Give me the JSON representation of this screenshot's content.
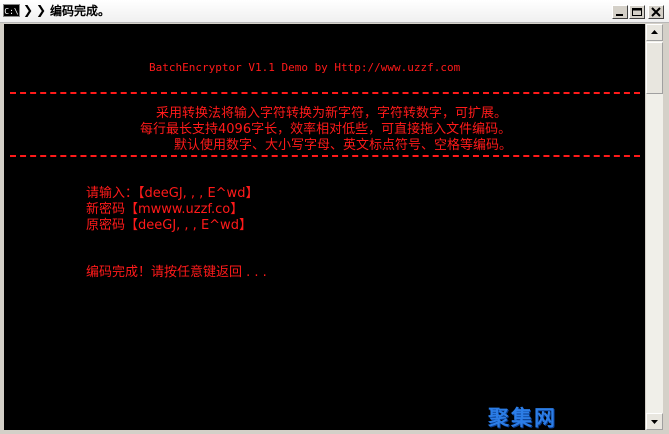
{
  "window": {
    "icon_label": "C:\\",
    "breadcrumb_1": "❯",
    "breadcrumb_2": "❯",
    "title": "编码完成。"
  },
  "console": {
    "banner": "BatchEncryptor V1.1 Demo by Http://www.uzzf.com",
    "desc_1": "采用转换法将输入字符转换为新字符，字符转数字，可扩展。",
    "desc_2": "每行最长支持4096字长，效率相对低些，可直接拖入文件编码。",
    "desc_3": "默认使用数字、大小写字母、英文标点符号、空格等编码。",
    "input_line": "请输入：【deeGJ, , , E^wd】",
    "new_pwd_line": "新密码【mwww.uzzf.co】",
    "orig_pwd_line": "原密码【deeGJ, , , E^wd】",
    "done_line": "编码完成！请按任意键返回 . . ."
  },
  "watermark": {
    "text": "聚集网"
  },
  "colors": {
    "console_bg": "#000000",
    "console_text": "#ff1a1a",
    "watermark": "#2c7de6"
  }
}
